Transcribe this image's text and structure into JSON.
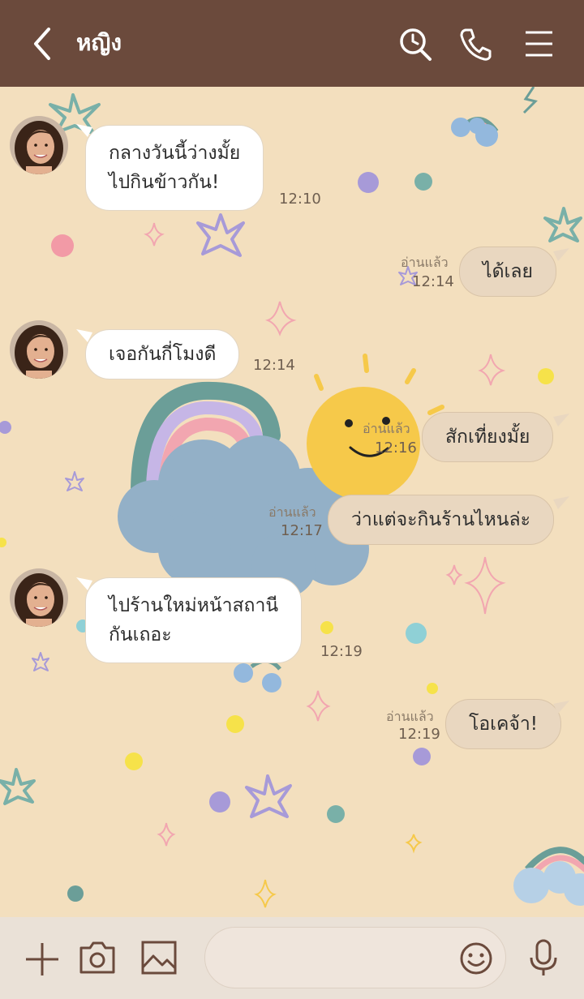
{
  "header": {
    "title": "หญิง",
    "icons": [
      "back-icon",
      "search-icon",
      "phone-icon",
      "menu-icon"
    ]
  },
  "messages": [
    {
      "from": "in",
      "text_lines": [
        "กลางวันนี้ว่างมั้ย",
        "ไปกินข้าวกัน!"
      ],
      "time": "12:10"
    },
    {
      "from": "out",
      "text": "ได้เลย",
      "read": "อ่านแล้ว",
      "time": "12:14"
    },
    {
      "from": "in",
      "text_lines": [
        "เจอกันกี่โมงดี"
      ],
      "time": "12:14"
    },
    {
      "from": "out",
      "text": "สักเที่ยงมั้ย",
      "read": "อ่านแล้ว",
      "time": "12:16"
    },
    {
      "from": "out",
      "text": "ว่าแต่จะกินร้านไหนล่ะ",
      "read": "อ่านแล้ว",
      "time": "12:17"
    },
    {
      "from": "in",
      "text_lines": [
        "ไปร้านใหม่หน้าสถานี",
        "กันเถอะ"
      ],
      "time": "12:19"
    },
    {
      "from": "out",
      "text": "โอเคจ้า!",
      "read": "อ่านแล้ว",
      "time": "12:19"
    }
  ],
  "footer": {
    "icons": [
      "plus-icon",
      "camera-icon",
      "image-icon",
      "emoji-icon",
      "mic-icon"
    ],
    "input_value": ""
  },
  "colors": {
    "header": "#6b4a3c",
    "background": "#f3dfbe",
    "incoming_bubble": "#ffffff",
    "outgoing_bubble": "#e9d7c0",
    "footer": "#eae1d7"
  }
}
